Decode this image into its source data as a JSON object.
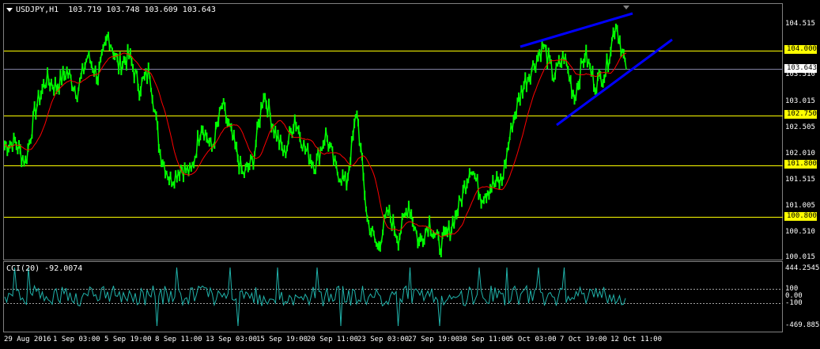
{
  "chart": {
    "symbol": "USDJPY,H1",
    "ohlc": [
      "103.719",
      "103.748",
      "103.609",
      "103.643"
    ],
    "current_price": "103.643"
  },
  "price_axis": [
    "104.515",
    "103.510",
    "103.015",
    "102.505",
    "102.010",
    "101.515",
    "101.005",
    "100.510",
    "100.015"
  ],
  "horizontal_levels": [
    {
      "price": "104.000",
      "color": "#ffff00"
    },
    {
      "price": "102.750",
      "color": "#ffff00"
    },
    {
      "price": "101.800",
      "color": "#ffff00"
    },
    {
      "price": "100.800",
      "color": "#ffff00"
    }
  ],
  "time_axis": [
    "29 Aug 2016",
    "1 Sep 03:00",
    "5 Sep 19:00",
    "8 Sep 11:00",
    "13 Sep 03:00",
    "15 Sep 19:00",
    "20 Sep 11:00",
    "23 Sep 03:00",
    "27 Sep 19:00",
    "30 Sep 11:00",
    "5 Oct 03:00",
    "7 Oct 19:00",
    "12 Oct 11:00"
  ],
  "cci": {
    "label": "CCI(20) -92.0074",
    "axis": [
      "444.2545",
      "100",
      "0.00",
      "-100",
      "-469.8855"
    ]
  },
  "colors": {
    "price_line": "#00ff00",
    "moving_average": "#ff0000",
    "trendlines": "#0000ff",
    "cci_line": "#20b2aa",
    "level_lines": "#ffff00",
    "current_price_line": "#8080a0"
  },
  "chart_data": {
    "type": "line",
    "series": [
      {
        "name": "USDJPY,H1",
        "values": [
          102.18,
          102.25,
          101.85,
          102.9,
          103.45,
          103.3,
          103.6,
          103.2,
          103.9,
          103.5,
          104.3,
          103.7,
          103.9,
          103.3,
          103.6,
          102.05,
          101.5,
          101.75,
          101.65,
          102.6,
          102.1,
          102.95,
          102.3,
          101.6,
          101.9,
          103.2,
          102.5,
          102.0,
          102.7,
          102.1,
          101.8,
          102.4,
          101.7,
          101.45,
          102.85,
          100.75,
          100.2,
          100.9,
          100.4,
          101.05,
          100.3,
          100.7,
          100.25,
          100.55,
          101.1,
          101.8,
          101.2,
          101.4,
          101.5,
          102.6,
          103.3,
          103.7,
          104.1,
          103.5,
          103.9,
          103.1,
          103.95,
          103.35,
          103.6,
          104.55,
          103.64
        ]
      }
    ]
  }
}
